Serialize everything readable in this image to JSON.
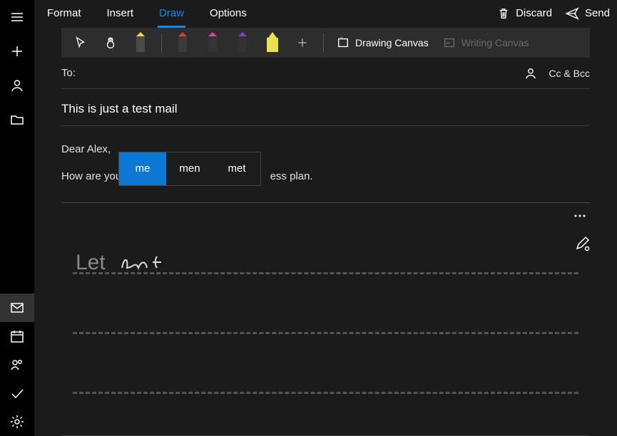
{
  "tabs": {
    "format": "Format",
    "insert": "Insert",
    "draw": "Draw",
    "options": "Options"
  },
  "actions": {
    "discard": "Discard",
    "send": "Send"
  },
  "toolstrip": {
    "drawing_canvas": "Drawing Canvas",
    "writing_canvas": "Writing Canvas"
  },
  "fields": {
    "to_label": "To:",
    "ccbcc": "Cc & Bcc"
  },
  "subject": "This is just a test mail",
  "body": {
    "line1": "Dear Alex,",
    "line2_pre": "How are you",
    "line2_post": "ess plan."
  },
  "suggestions": {
    "a": "me",
    "b": "men",
    "c": "met"
  },
  "ink": {
    "recognized": "Let"
  },
  "pen_colors": {
    "p1_tip": "#f9d43a",
    "p1_body": "#4a4a4a",
    "p2_tip": "#d0423c",
    "p2_body": "#3a3a3a",
    "p3_tip": "#e03fa0",
    "p3_body": "#343434",
    "p4_tip": "#7a3fe0",
    "p4_body": "#323232",
    "p5_body": "#e9e24b",
    "p5_tip": "#e9e24b"
  }
}
